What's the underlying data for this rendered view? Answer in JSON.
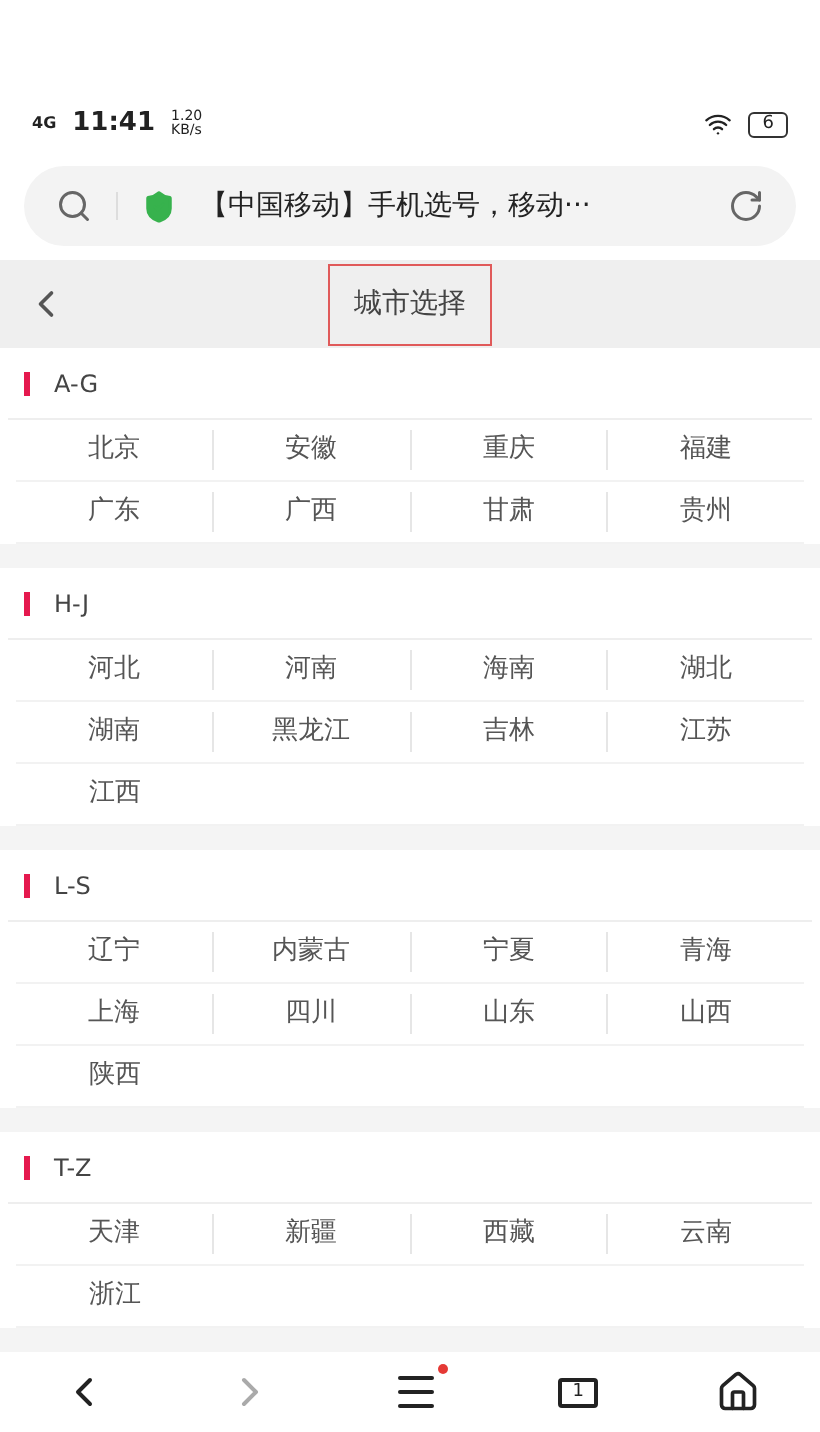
{
  "status_bar": {
    "network": "4G",
    "time": "11:41",
    "speed": "1.20 KB/s",
    "battery": "6"
  },
  "address_bar": {
    "title": "【中国移动】手机选号，移动···"
  },
  "header": {
    "title": "城市选择",
    "highlighted": true
  },
  "sections": [
    {
      "label": "A-G",
      "cities": [
        "北京",
        "安徽",
        "重庆",
        "福建",
        "广东",
        "广西",
        "甘肃",
        "贵州"
      ]
    },
    {
      "label": "H-J",
      "cities": [
        "河北",
        "河南",
        "海南",
        "湖北",
        "湖南",
        "黑龙江",
        "吉林",
        "江苏",
        "江西"
      ]
    },
    {
      "label": "L-S",
      "cities": [
        "辽宁",
        "内蒙古",
        "宁夏",
        "青海",
        "上海",
        "四川",
        "山东",
        "山西",
        "陕西"
      ]
    },
    {
      "label": "T-Z",
      "cities": [
        "天津",
        "新疆",
        "西藏",
        "云南",
        "浙江"
      ]
    }
  ],
  "bottom_nav": {
    "tabs_count": "1",
    "menu_badge": true
  }
}
